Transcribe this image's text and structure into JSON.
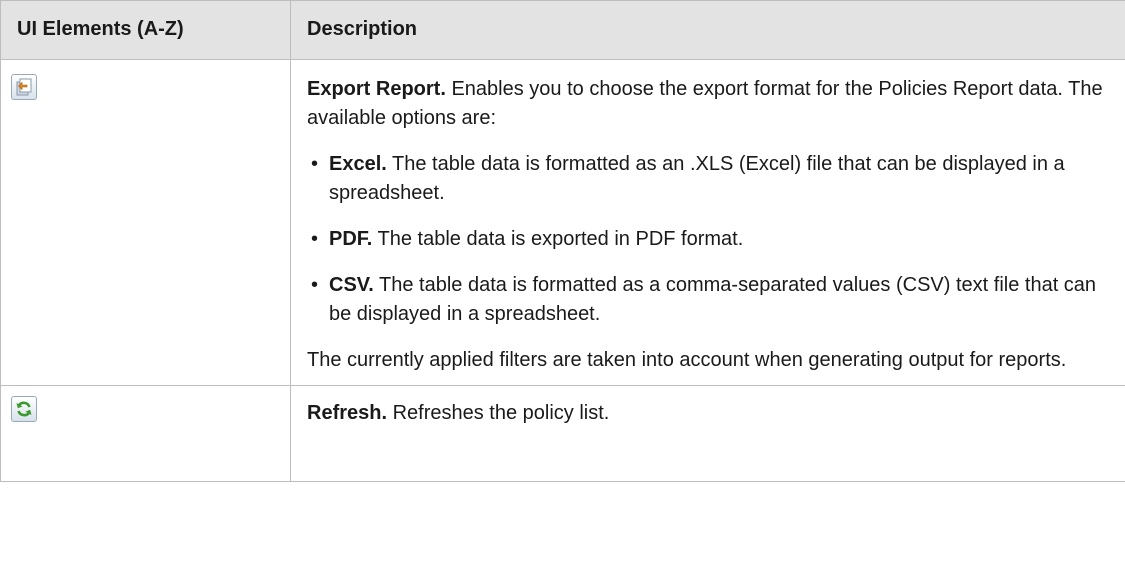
{
  "table": {
    "headers": {
      "col1": "UI Elements (A-Z)",
      "col2": "Description"
    },
    "rows": [
      {
        "icon": "export-report-icon",
        "title": "Export Report.",
        "intro": " Enables you to choose the export format for the Policies Report data. The available options are:",
        "options": [
          {
            "name": "Excel.",
            "text": " The table data is formatted as an .XLS (Excel) file that can be displayed in a spreadsheet."
          },
          {
            "name": "PDF.",
            "text": " The table data is exported in PDF format."
          },
          {
            "name": "CSV.",
            "text": " The table data is formatted as a comma-separated values (CSV) text file that can be displayed in a spreadsheet."
          }
        ],
        "note": "The currently applied filters are taken into account when generating output for reports."
      },
      {
        "icon": "refresh-icon",
        "title": "Refresh.",
        "intro": " Refreshes the policy list."
      }
    ]
  },
  "colors": {
    "header_bg": "#e3e3e3",
    "border": "#bdbdbd",
    "refresh_green": "#3a9a2e",
    "export_orange": "#e08a1e"
  }
}
